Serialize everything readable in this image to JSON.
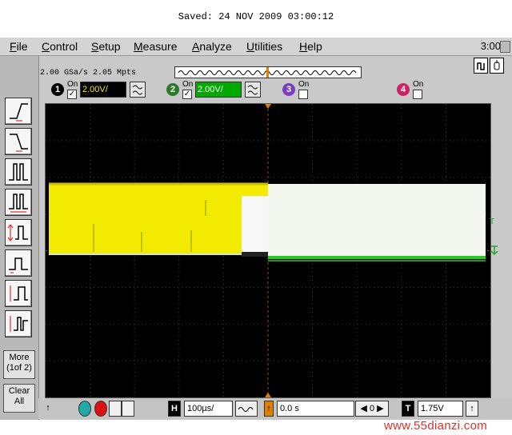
{
  "header": {
    "saved_text": "Saved:  24 NOV 2009  03:00:12"
  },
  "menu": {
    "items": [
      "File",
      "Control",
      "Setup",
      "Measure",
      "Analyze",
      "Utilities",
      "Help"
    ],
    "clock": "3:00"
  },
  "status": {
    "sample_info": "2.00 GSa/s   2.05 Mpts"
  },
  "channels": [
    {
      "number": "1",
      "on_label": "On",
      "checked": "✓",
      "scale": "2.00V/",
      "color": "#f2ea00"
    },
    {
      "number": "2",
      "on_label": "On",
      "checked": "✓",
      "scale": "2.00V/",
      "color": "#00cc00"
    },
    {
      "number": "3",
      "on_label": "On",
      "checked": "",
      "scale": "",
      "color": "#8844cc"
    },
    {
      "number": "4",
      "on_label": "On",
      "checked": "",
      "scale": "",
      "color": "#dd3377"
    }
  ],
  "sidebar": {
    "more_label_1": "More",
    "more_label_2": "(1of 2)",
    "clear_label_1": "Clear",
    "clear_label_2": "All"
  },
  "bottom": {
    "h_label": "H",
    "timebase": "100µs/",
    "delay": "0.0 s",
    "t_label": "T",
    "trigger_level": "1.75V"
  },
  "markers": {
    "trigger_level": "T"
  },
  "watermark": {
    "text": "www.55dianzi.com"
  }
}
